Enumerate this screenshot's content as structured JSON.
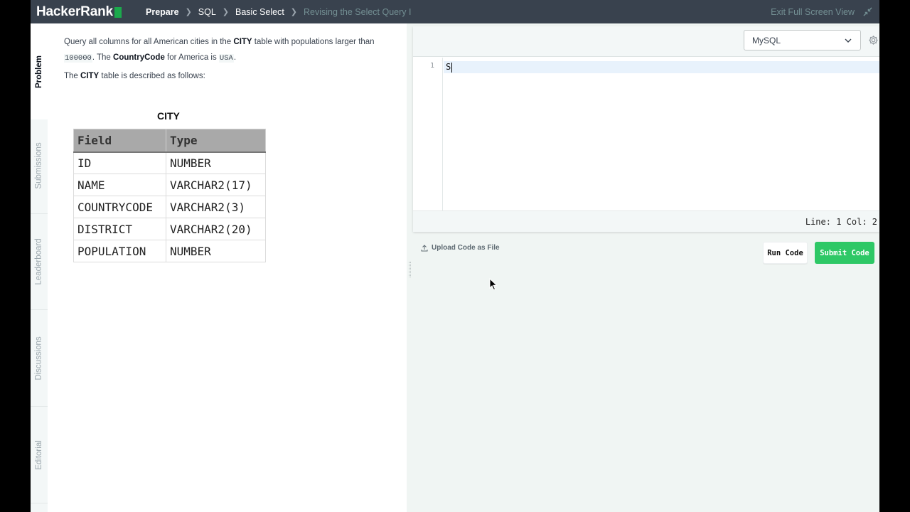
{
  "topbar": {
    "logo_text": "HackerRank",
    "breadcrumbs": [
      "Prepare",
      "SQL",
      "Basic Select",
      "Revising the Select Query I"
    ],
    "exit_fullscreen": "Exit Full Screen View"
  },
  "tabs": [
    "Problem",
    "Submissions",
    "Leaderboard",
    "Discussions",
    "Editorial"
  ],
  "problem": {
    "p1_a": "Query all columns for all American cities in the ",
    "p1_city": "CITY",
    "p1_b": " table with populations larger than ",
    "p1_num": "100000",
    "p1_c": ". The ",
    "p1_cc": "CountryCode",
    "p1_d": " for America is ",
    "p1_usa": "USA",
    "p1_e": ".",
    "p2_a": "The ",
    "p2_city": "CITY",
    "p2_b": " table is described as follows:",
    "table_title": "CITY",
    "table_headers": [
      "Field",
      "Type"
    ],
    "table_rows": [
      [
        "ID",
        "NUMBER"
      ],
      [
        "NAME",
        "VARCHAR2(17)"
      ],
      [
        "COUNTRYCODE",
        "VARCHAR2(3)"
      ],
      [
        "DISTRICT",
        "VARCHAR2(20)"
      ],
      [
        "POPULATION",
        "NUMBER"
      ]
    ]
  },
  "editor": {
    "language": "MySQL",
    "line_number": "1",
    "code": "S",
    "status": "Line: 1 Col: 2"
  },
  "actions": {
    "upload": "Upload Code as File",
    "run": "Run Code",
    "submit": "Submit Code"
  },
  "colors": {
    "topbar": "#39424e",
    "brand_green": "#1ba94c",
    "submit_green": "#2ec866"
  }
}
